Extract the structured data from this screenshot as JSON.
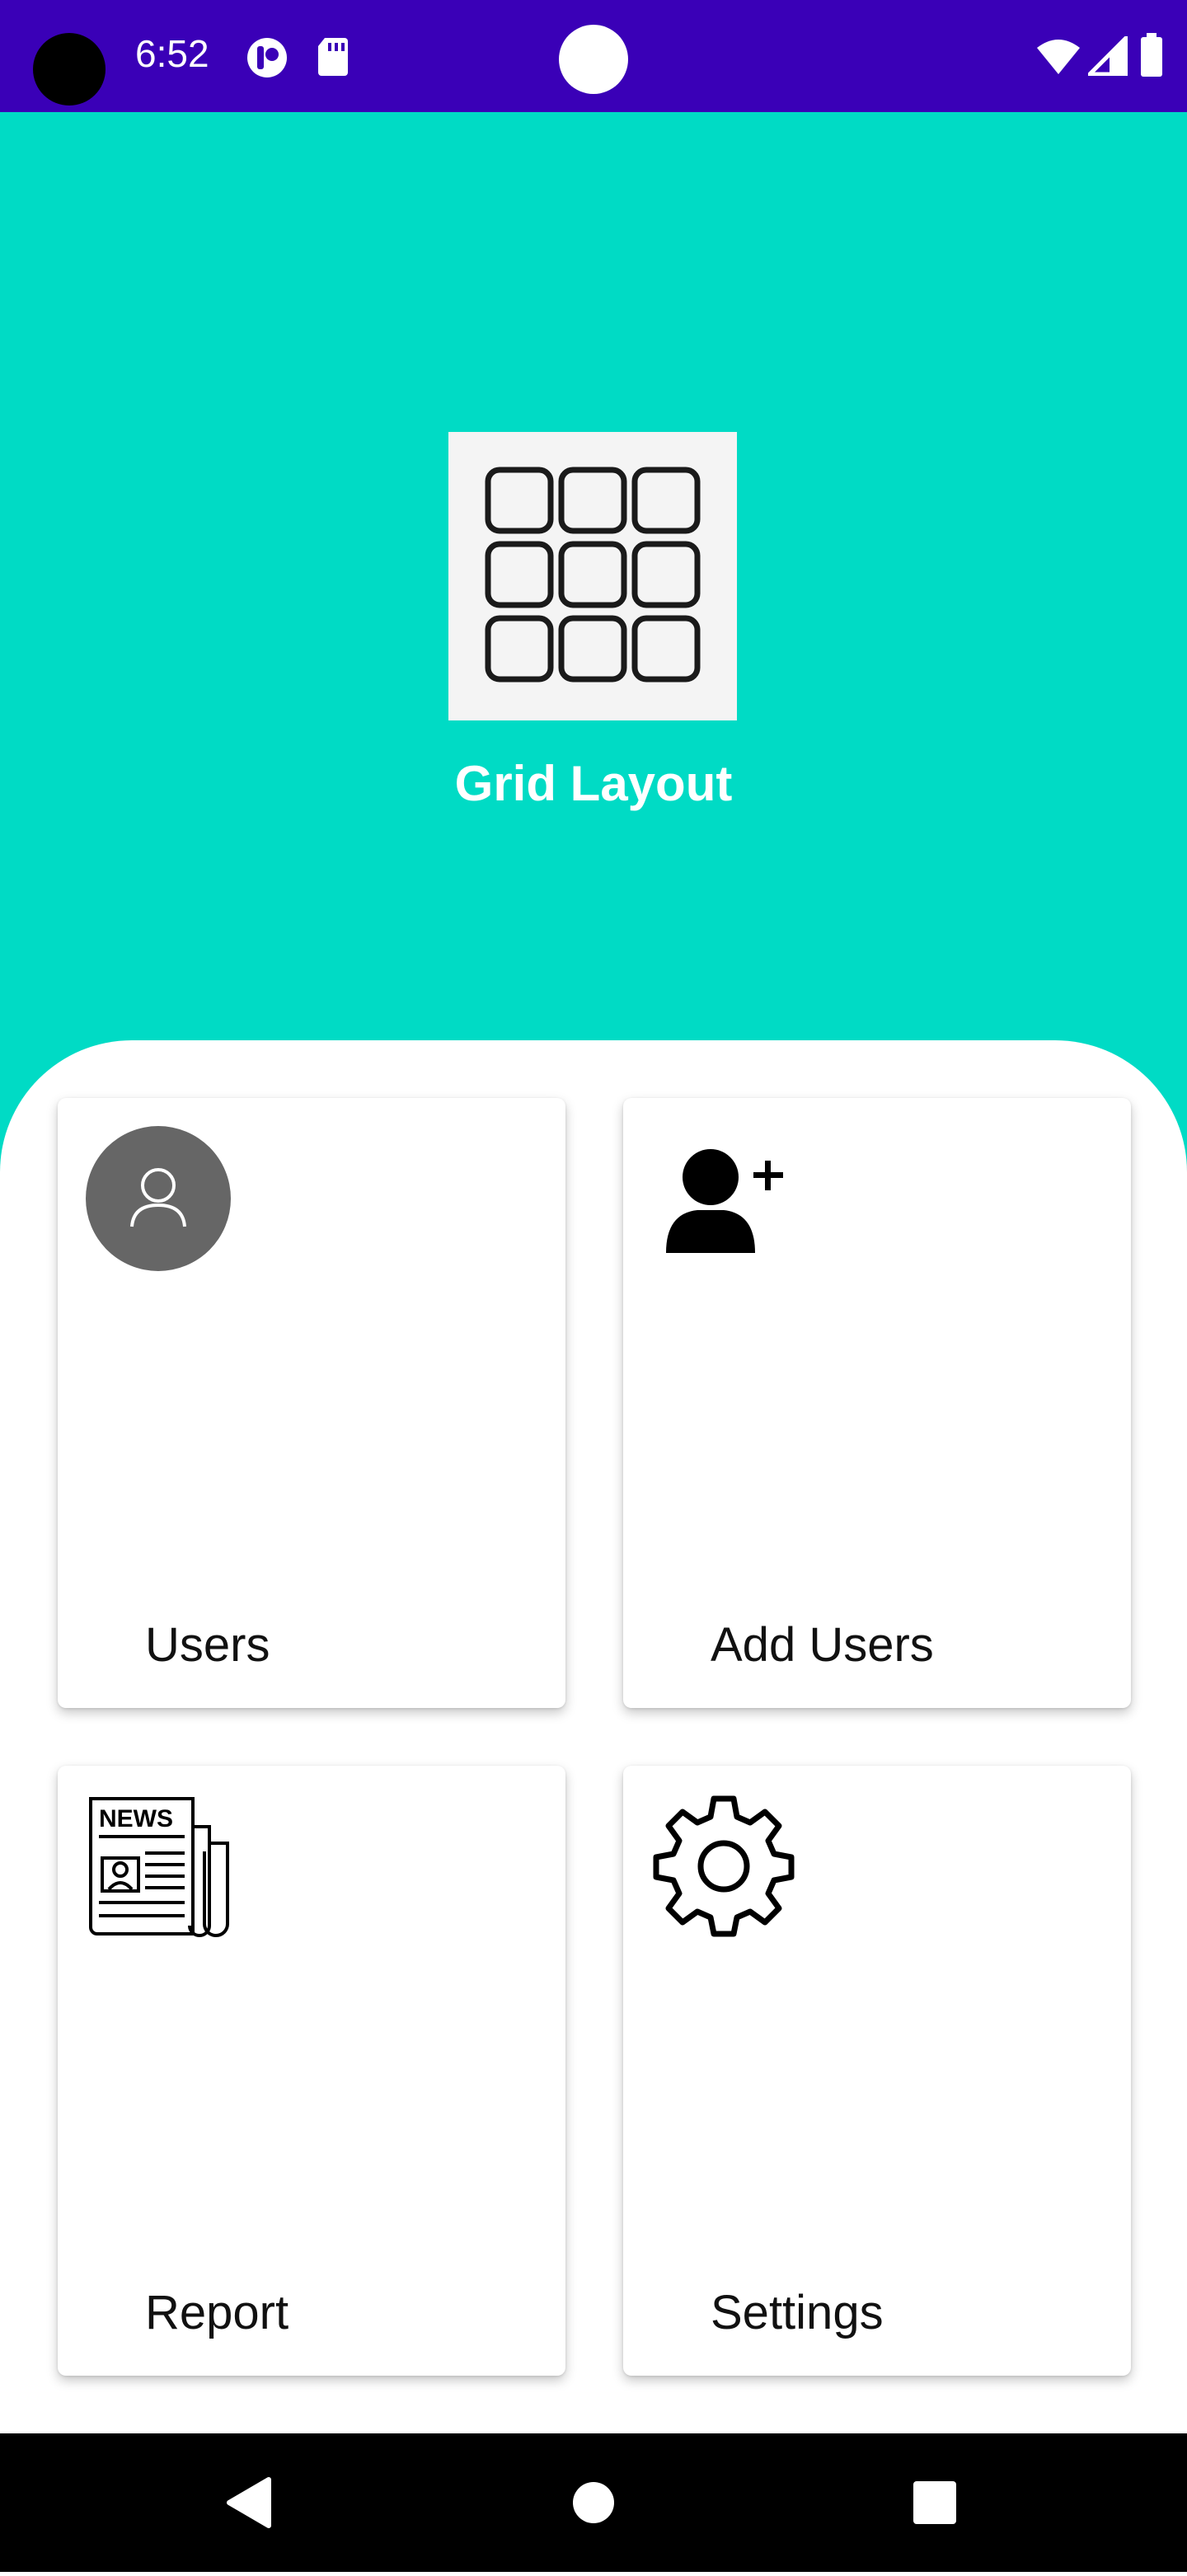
{
  "status_bar": {
    "time": "6:52",
    "icons": [
      "camera-cutout",
      "app-notification-icon",
      "sd-card-icon",
      "wifi-icon",
      "signal-icon",
      "battery-icon"
    ]
  },
  "header": {
    "logo_icon": "grid-icon",
    "title": "Grid Layout",
    "background_color": "#00dbc5"
  },
  "menu": {
    "items": [
      {
        "label": "Users",
        "icon": "user-avatar-icon"
      },
      {
        "label": "Add Users",
        "icon": "add-user-icon"
      },
      {
        "label": "Report",
        "icon": "newspaper-icon"
      },
      {
        "label": "Settings",
        "icon": "gear-icon"
      }
    ]
  },
  "nav_bar": {
    "buttons": [
      "back-button",
      "home-button",
      "recents-button"
    ]
  }
}
